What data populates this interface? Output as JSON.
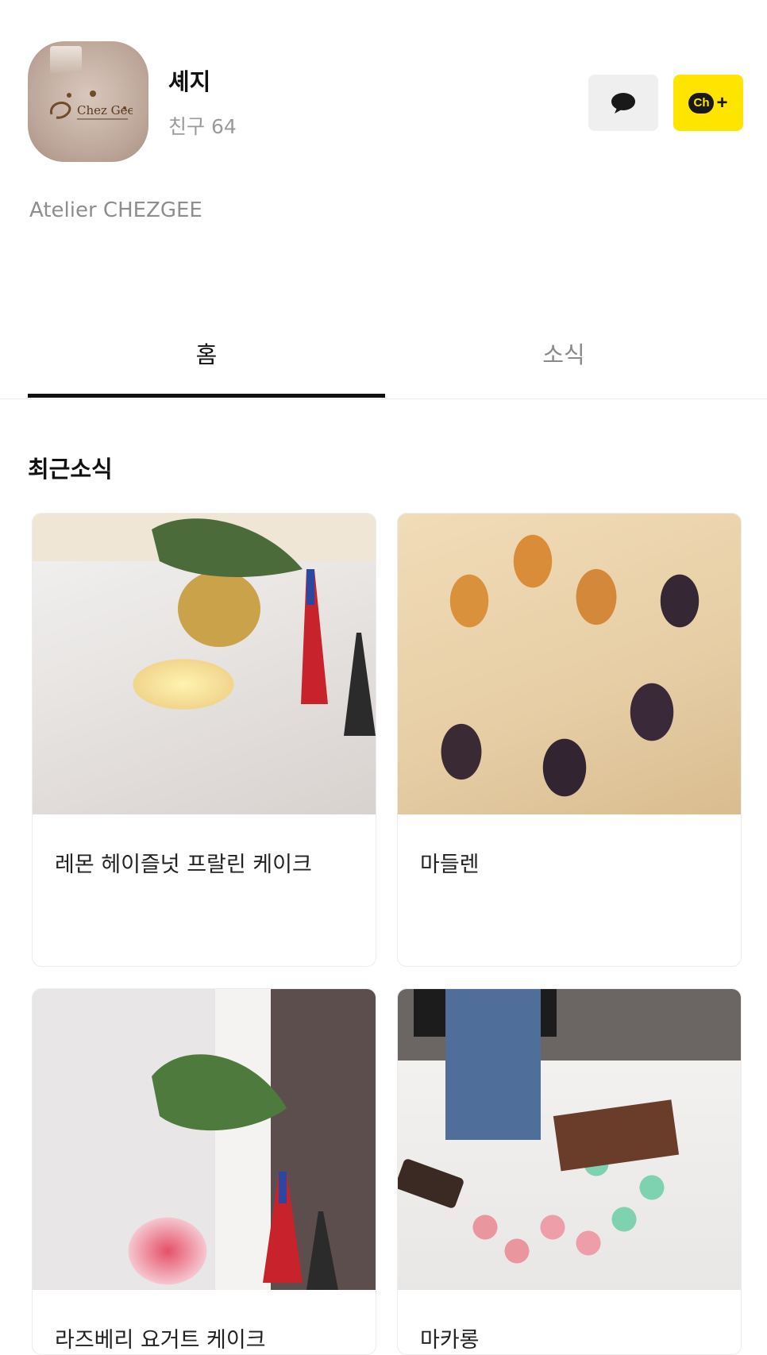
{
  "profile": {
    "name": "셰지",
    "friends_label": "친구",
    "friends_count": "64",
    "description": "Atelier CHEZGEE",
    "avatar_logo_text": "Chez Gee"
  },
  "actions": {
    "chat_icon": "chat-bubble-icon",
    "add_channel_badge": "Ch",
    "add_channel_plus": "+"
  },
  "tabs": [
    {
      "label": "홈",
      "active": true
    },
    {
      "label": "소식",
      "active": false
    }
  ],
  "section": {
    "title": "최근소식"
  },
  "posts": [
    {
      "title": "레몬 헤이즐넛 프랄린 케이크"
    },
    {
      "title": "마들렌"
    },
    {
      "title": "라즈베리 요거트 케이크"
    },
    {
      "title": "마카롱"
    }
  ],
  "colors": {
    "brand_yellow": "#fee500",
    "chat_button_bg": "#efefef",
    "active_tab": "#111111",
    "muted_text": "#9a9a9a"
  }
}
